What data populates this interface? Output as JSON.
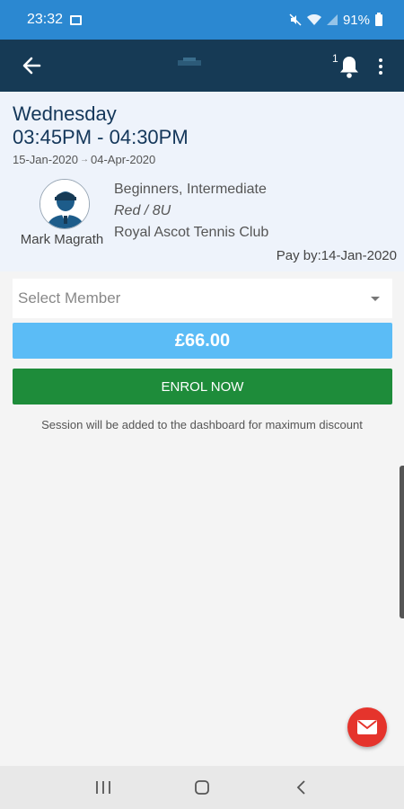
{
  "status_bar": {
    "time": "23:32",
    "battery": "91%",
    "icons": [
      "gallery-icon",
      "mute-icon",
      "wifi-icon",
      "signal-icon",
      "battery-icon"
    ]
  },
  "app_bar": {
    "notification_count": "1",
    "colors": {
      "background": "#163a55"
    }
  },
  "session": {
    "day": "Wednesday",
    "time_range": "03:45PM - 04:30PM",
    "start_date": "15-Jan-2020",
    "date_arrow": "→",
    "end_date": "04-Apr-2020",
    "coach_name": "Mark Magrath",
    "levels": "Beginners, Intermediate",
    "group": "Red / 8U",
    "venue": "Royal Ascot Tennis Club",
    "pay_by": "Pay by:14-Jan-2020"
  },
  "enrol": {
    "member_select_placeholder": "Select Member",
    "price": "£66.00",
    "enrol_button": "ENROL NOW",
    "note": "Session will be added to the dashboard for maximum discount"
  },
  "colors": {
    "status_bar": "#2b88d1",
    "price_bg": "#5bbcf6",
    "enrol_bg": "#1e8c3a",
    "fab_bg": "#e5342c"
  }
}
